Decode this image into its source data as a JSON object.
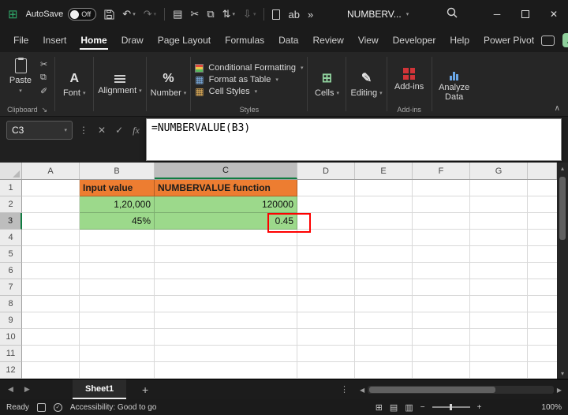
{
  "colors": {
    "accent_green": "#107C41",
    "cell_orange": "#ED7D31",
    "cell_green": "#9CD98B",
    "annotation_red": "#FE0000"
  },
  "titlebar": {
    "autosave_label": "AutoSave",
    "autosave_state": "Off",
    "doc_title": "NUMBERV...",
    "overflow": "»"
  },
  "menubar": {
    "tabs": [
      "File",
      "Insert",
      "Home",
      "Draw",
      "Page Layout",
      "Formulas",
      "Data",
      "Review",
      "View",
      "Developer",
      "Help",
      "Power Pivot"
    ],
    "active_tab": "Home"
  },
  "ribbon": {
    "paste_label": "Paste",
    "clipboard_group_label": "Clipboard",
    "font_label": "Font",
    "alignment_label": "Alignment",
    "number_label": "Number",
    "conditional_formatting_label": "Conditional Formatting",
    "format_as_table_label": "Format as Table",
    "cell_styles_label": "Cell Styles",
    "styles_group_label": "Styles",
    "cells_label": "Cells",
    "editing_label": "Editing",
    "addins_label": "Add-ins",
    "addins_group_label": "Add-ins",
    "analyze_data_label": "Analyze Data"
  },
  "formula_bar": {
    "name_box_value": "C3",
    "fx_label": "fx",
    "formula": "=NUMBERVALUE(B3)"
  },
  "sheet": {
    "columns": [
      "A",
      "B",
      "C",
      "D",
      "E",
      "F",
      "G"
    ],
    "rows": [
      "1",
      "2",
      "3",
      "4",
      "5",
      "6",
      "7",
      "8",
      "9",
      "10",
      "11",
      "12"
    ],
    "active_cell": "C3",
    "cells": [
      {
        "ref": "B1",
        "text": "Input value",
        "style": "orange-header"
      },
      {
        "ref": "C1",
        "text": "NUMBERVALUE function",
        "style": "orange-header"
      },
      {
        "ref": "B2",
        "text": "1,20,000",
        "style": "green-value"
      },
      {
        "ref": "C2",
        "text": "120000",
        "style": "green-value"
      },
      {
        "ref": "B3",
        "text": "45%",
        "style": "green-value"
      },
      {
        "ref": "C3",
        "text": "0.45",
        "style": "green-value-highlighted"
      }
    ]
  },
  "sheet_tabs": {
    "active_tab": "Sheet1",
    "new_sheet_label": "+"
  },
  "statusbar": {
    "mode": "Ready",
    "accessibility": "Accessibility: Good to go",
    "zoom": "100%"
  }
}
